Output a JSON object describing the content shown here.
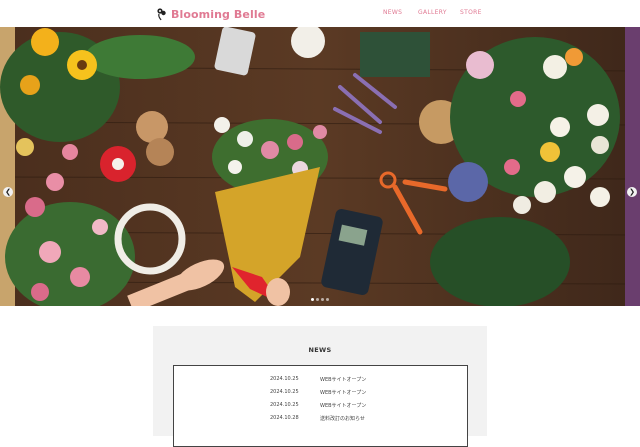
{
  "brand": {
    "name": "Blooming Belle",
    "color": "#e07a93",
    "icon": "flower-logo-icon"
  },
  "nav": {
    "items": [
      {
        "label": "NEWS"
      },
      {
        "label": "GALLERY"
      },
      {
        "label": "STORE"
      }
    ]
  },
  "hero": {
    "image": "florist workbench with flowers, twine, scissors and card reader",
    "prev_icon": "chevron-left-icon",
    "next_icon": "chevron-right-icon",
    "slide_count": 4,
    "active_slide": 1
  },
  "news": {
    "title": "NEWS",
    "items": [
      {
        "date": "2024.10.25",
        "text": "WEBサイトオープン"
      },
      {
        "date": "2024.10.25",
        "text": "WEBサイトオープン"
      },
      {
        "date": "2024.10.25",
        "text": "WEBサイトオープン"
      },
      {
        "date": "2024.10.28",
        "text": "送料改訂のお知らせ"
      }
    ]
  }
}
